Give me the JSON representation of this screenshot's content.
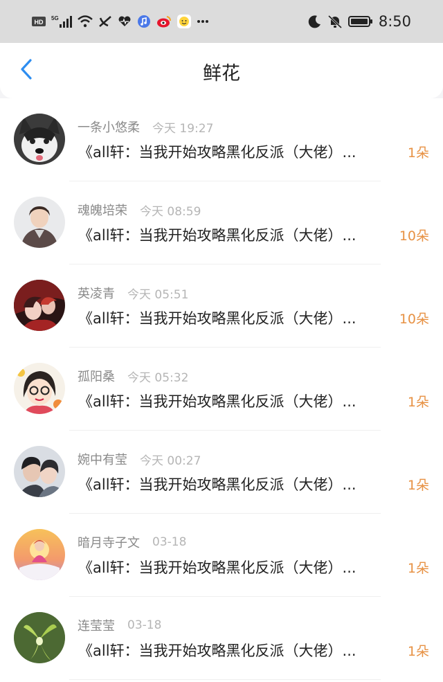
{
  "status_bar": {
    "hd": "HD",
    "signal": "5G",
    "time": "8:50",
    "icons": [
      "hd-icon",
      "signal-icon",
      "wifi-icon",
      "no-call-icon",
      "heart-icon",
      "music-icon",
      "weibo-icon",
      "emoji-app-icon",
      "more-icon",
      "moon-icon",
      "bell-off-icon",
      "battery-icon"
    ]
  },
  "header": {
    "title": "鲜花",
    "back_icon": "chevron-left-icon"
  },
  "colors": {
    "accent_blue": "#2d8df0",
    "count_orange": "#e79143"
  },
  "items": [
    {
      "username": "一条小悠柔",
      "time": "今天 19:27",
      "book": "《all轩：当我开始攻略黑化反派（大佬）...",
      "count": "1朵",
      "avatar": "husky-avatar"
    },
    {
      "username": "魂魄培荣",
      "time": "今天 08:59",
      "book": "《all轩：当我开始攻略黑化反派（大佬）...",
      "count": "10朵",
      "avatar": "boy-avatar"
    },
    {
      "username": "英凌青",
      "time": "今天 05:51",
      "book": "《all轩：当我开始攻略黑化反派（大佬）...",
      "count": "10朵",
      "avatar": "anime-avatar"
    },
    {
      "username": "孤阳桑",
      "time": "今天 05:32",
      "book": "《all轩：当我开始攻略黑化反派（大佬）...",
      "count": "1朵",
      "avatar": "cartoon-girl-avatar"
    },
    {
      "username": "婉中有莹",
      "time": "今天 00:27",
      "book": "《all轩：当我开始攻略黑化反派（大佬）...",
      "count": "1朵",
      "avatar": "couple-avatar"
    },
    {
      "username": "暗月寺子文",
      "time": "03-18",
      "book": "《all轩：当我开始攻略黑化反派（大佬）...",
      "count": "1朵",
      "avatar": "sunset-girl-avatar"
    },
    {
      "username": "连莹莹",
      "time": "03-18",
      "book": "《all轩：当我开始攻略黑化反派（大佬）...",
      "count": "1朵",
      "avatar": "orchid-avatar"
    }
  ]
}
